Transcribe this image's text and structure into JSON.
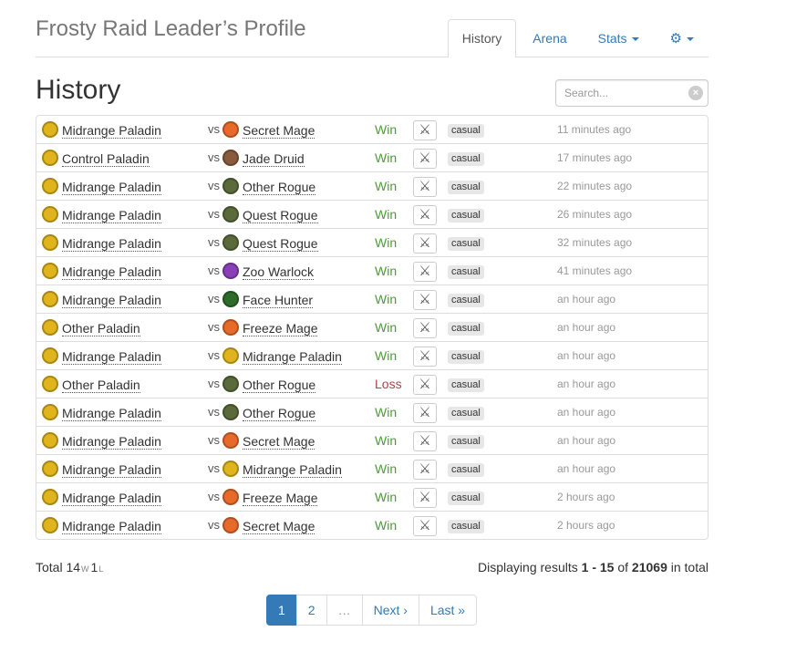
{
  "header": {
    "title": "Frosty Raid Leader’s Profile",
    "tabs": [
      {
        "label": "History"
      },
      {
        "label": "Arena"
      },
      {
        "label": "Stats"
      }
    ]
  },
  "history": {
    "title": "History",
    "search_placeholder": "Search...",
    "vs_label": "vs",
    "mode_icon": "crossed-swords-icon",
    "games": [
      {
        "deck": "Midrange Paladin",
        "opponent": "Secret Mage",
        "result": "Win",
        "tag": "casual",
        "time": "11 minutes ago"
      },
      {
        "deck": "Control Paladin",
        "opponent": "Jade Druid",
        "result": "Win",
        "tag": "casual",
        "time": "17 minutes ago"
      },
      {
        "deck": "Midrange Paladin",
        "opponent": "Other Rogue",
        "result": "Win",
        "tag": "casual",
        "time": "22 minutes ago"
      },
      {
        "deck": "Midrange Paladin",
        "opponent": "Quest Rogue",
        "result": "Win",
        "tag": "casual",
        "time": "26 minutes ago"
      },
      {
        "deck": "Midrange Paladin",
        "opponent": "Quest Rogue",
        "result": "Win",
        "tag": "casual",
        "time": "32 minutes ago"
      },
      {
        "deck": "Midrange Paladin",
        "opponent": "Zoo Warlock",
        "result": "Win",
        "tag": "casual",
        "time": "41 minutes ago"
      },
      {
        "deck": "Midrange Paladin",
        "opponent": "Face Hunter",
        "result": "Win",
        "tag": "casual",
        "time": "an hour ago"
      },
      {
        "deck": "Other Paladin",
        "opponent": "Freeze Mage",
        "result": "Win",
        "tag": "casual",
        "time": "an hour ago"
      },
      {
        "deck": "Midrange Paladin",
        "opponent": "Midrange Paladin",
        "result": "Win",
        "tag": "casual",
        "time": "an hour ago"
      },
      {
        "deck": "Other Paladin",
        "opponent": "Other Rogue",
        "result": "Loss",
        "tag": "casual",
        "time": "an hour ago"
      },
      {
        "deck": "Midrange Paladin",
        "opponent": "Other Rogue",
        "result": "Win",
        "tag": "casual",
        "time": "an hour ago"
      },
      {
        "deck": "Midrange Paladin",
        "opponent": "Secret Mage",
        "result": "Win",
        "tag": "casual",
        "time": "an hour ago"
      },
      {
        "deck": "Midrange Paladin",
        "opponent": "Midrange Paladin",
        "result": "Win",
        "tag": "casual",
        "time": "an hour ago"
      },
      {
        "deck": "Midrange Paladin",
        "opponent": "Freeze Mage",
        "result": "Win",
        "tag": "casual",
        "time": "2 hours ago"
      },
      {
        "deck": "Midrange Paladin",
        "opponent": "Secret Mage",
        "result": "Win",
        "tag": "casual",
        "time": "2 hours ago"
      }
    ]
  },
  "hero_colors": {
    "Paladin": "#e0b41c",
    "Mage": "#e86a2a",
    "Druid": "#8a5a3c",
    "Rogue": "#5a6a3a",
    "Warlock": "#8a3fb8",
    "Hunter": "#2e6a2a"
  },
  "result_colors": {
    "Win": "#4f9a3a",
    "Loss": "#b0414a"
  },
  "footer": {
    "total_label": "Total",
    "wins": "14",
    "wins_suffix": "W",
    "losses": "1",
    "losses_suffix": "L",
    "displaying_prefix": "Displaying results",
    "range": "1 - 15",
    "of_label": "of",
    "total_count": "21069",
    "in_total_label": "in total"
  },
  "pagination": [
    {
      "label": "1",
      "active": true
    },
    {
      "label": "2"
    },
    {
      "label": "…",
      "disabled": true
    },
    {
      "label": "Next ›"
    },
    {
      "label": "Last »"
    }
  ]
}
